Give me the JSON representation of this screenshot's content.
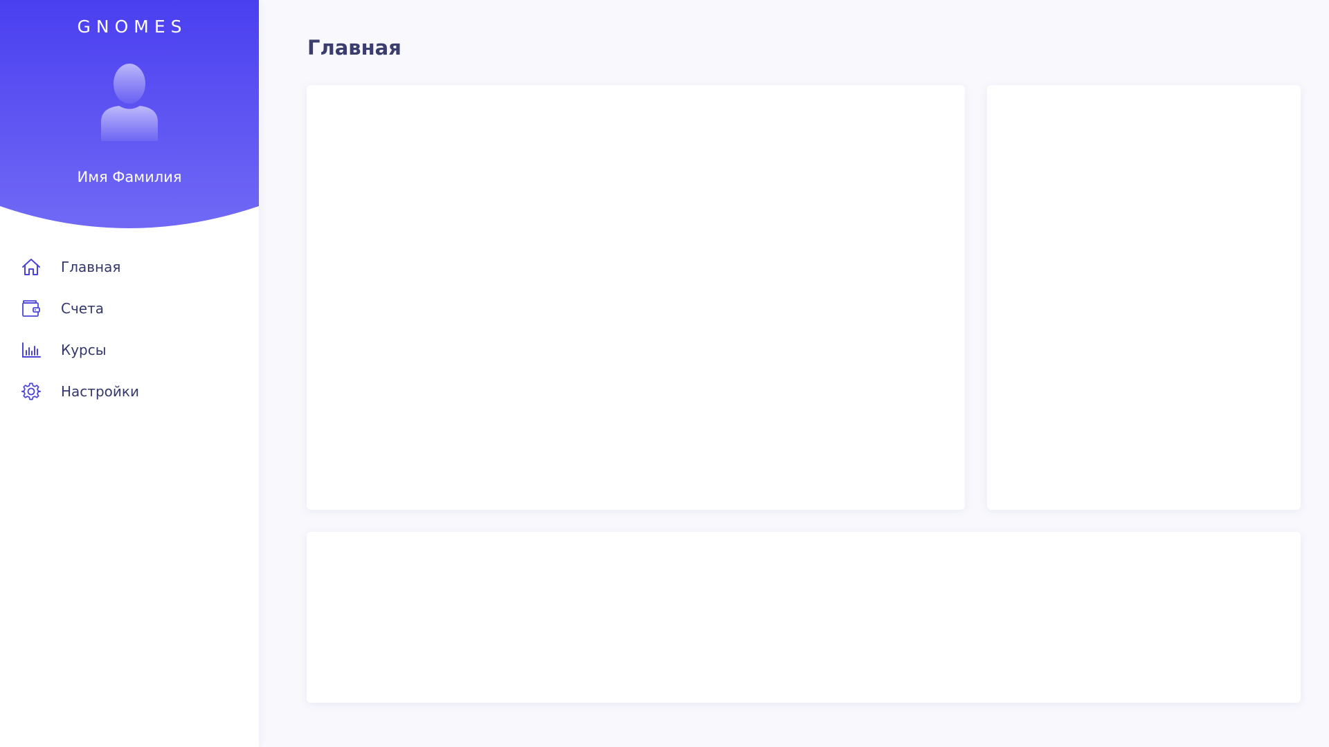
{
  "theme": {
    "accent": "#4a3ff0",
    "accent_light": "#7169f5",
    "nav_icon_color": "#4a43d8",
    "page_background": "#f8f8fd"
  },
  "sidebar": {
    "brand": "GNOMES",
    "user": {
      "avatar_icon": "user-silhouette-icon",
      "name": "Имя Фамилия"
    },
    "items": [
      {
        "label": "Главная",
        "icon": "home-icon"
      },
      {
        "label": "Счета",
        "icon": "wallet-icon"
      },
      {
        "label": "Курсы",
        "icon": "bar-chart-icon"
      },
      {
        "label": "Настройки",
        "icon": "gear-icon"
      }
    ]
  },
  "main": {
    "title": "Главная"
  }
}
